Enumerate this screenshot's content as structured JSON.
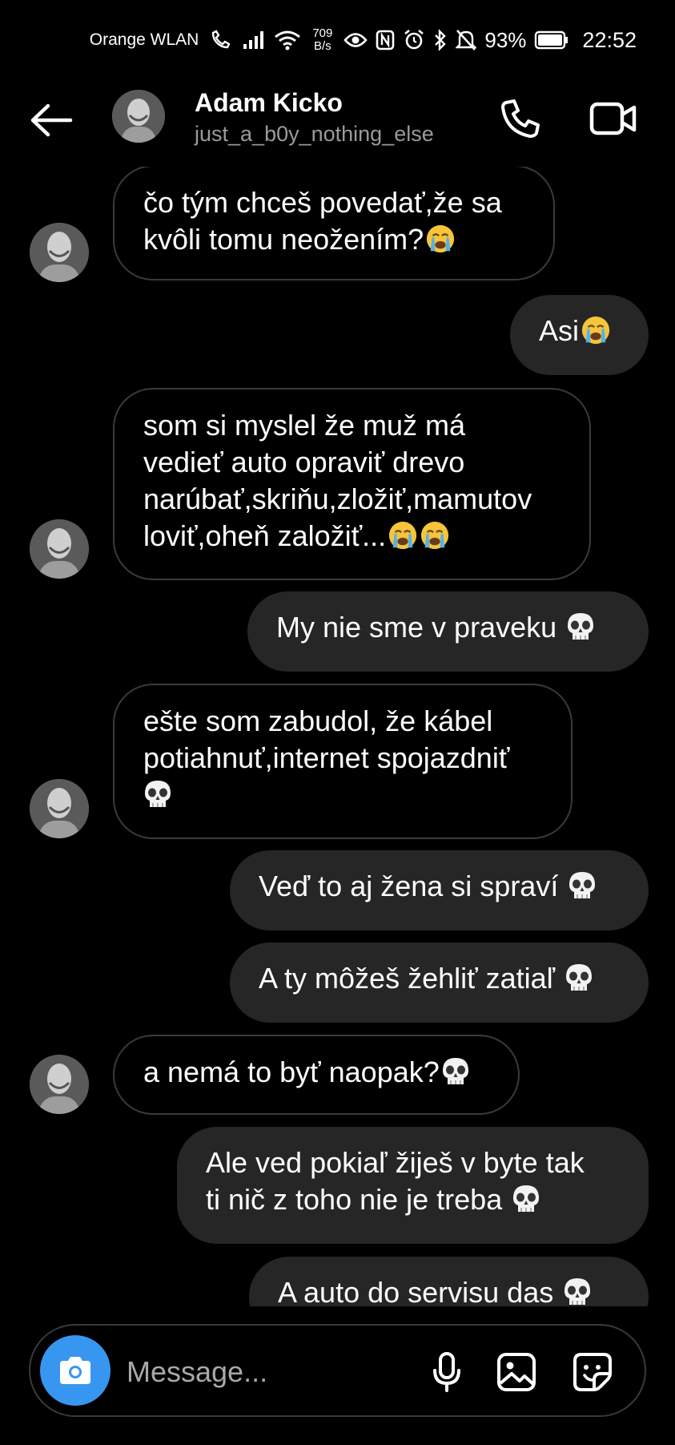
{
  "status_bar": {
    "carrier": "Orange WLAN",
    "net_speed_value": "709",
    "net_speed_unit": "B/s",
    "battery": "93%",
    "time": "22:52"
  },
  "header": {
    "name": "Adam Kicko",
    "username": "just_a_b0y_nothing_else"
  },
  "messages": [
    {
      "side": "in",
      "lines": [
        "čo tým chceš povedať,že sa",
        "kvôli tomu neožením?"
      ],
      "emoji": [
        "crying"
      ]
    },
    {
      "side": "out",
      "lines": [
        "Asi"
      ],
      "emoji": [
        "crying"
      ]
    },
    {
      "side": "in",
      "lines": [
        "som si myslel že muž má",
        "vedieť auto opraviť drevo",
        "narúbať,skriňu,zložiť,mamutov",
        "loviť,oheň založiť..."
      ],
      "emoji": [
        "crying",
        "crying"
      ]
    },
    {
      "side": "out",
      "lines": [
        "My nie sme v praveku"
      ],
      "emoji": [
        "skull"
      ]
    },
    {
      "side": "in",
      "lines": [
        "ešte som zabudol, že kábel",
        "potiahnuť,internet spojazdniť"
      ],
      "emoji": [
        "skull"
      ]
    },
    {
      "side": "out",
      "lines": [
        "Veď to aj žena si spraví"
      ],
      "emoji": [
        "skull"
      ]
    },
    {
      "side": "out",
      "lines": [
        "A ty môžeš žehliť zatiaľ"
      ],
      "emoji": [
        "skull"
      ]
    },
    {
      "side": "in",
      "lines": [
        "a nemá to byť naopak?"
      ],
      "emoji": [
        "skull"
      ]
    },
    {
      "side": "out",
      "lines": [
        "Ale ved pokiaľ žiješ v byte tak",
        "ti nič z toho nie je treba"
      ],
      "emoji": [
        "skull"
      ]
    },
    {
      "side": "out",
      "lines": [
        "A auto do servisu das"
      ],
      "emoji": [
        "skull"
      ]
    }
  ],
  "composer": {
    "placeholder": "Message..."
  },
  "icons": {
    "back": "arrow-left-icon",
    "call": "phone-icon",
    "video": "video-camera-icon",
    "camera": "camera-icon",
    "mic": "microphone-icon",
    "gallery": "image-icon",
    "sticker": "sticker-icon"
  },
  "colors": {
    "background": "#000000",
    "outgoing_bubble": "#262626",
    "incoming_border": "#3a3a3a",
    "camera_button": "#3797f0",
    "muted_text": "#9a9a9a"
  }
}
